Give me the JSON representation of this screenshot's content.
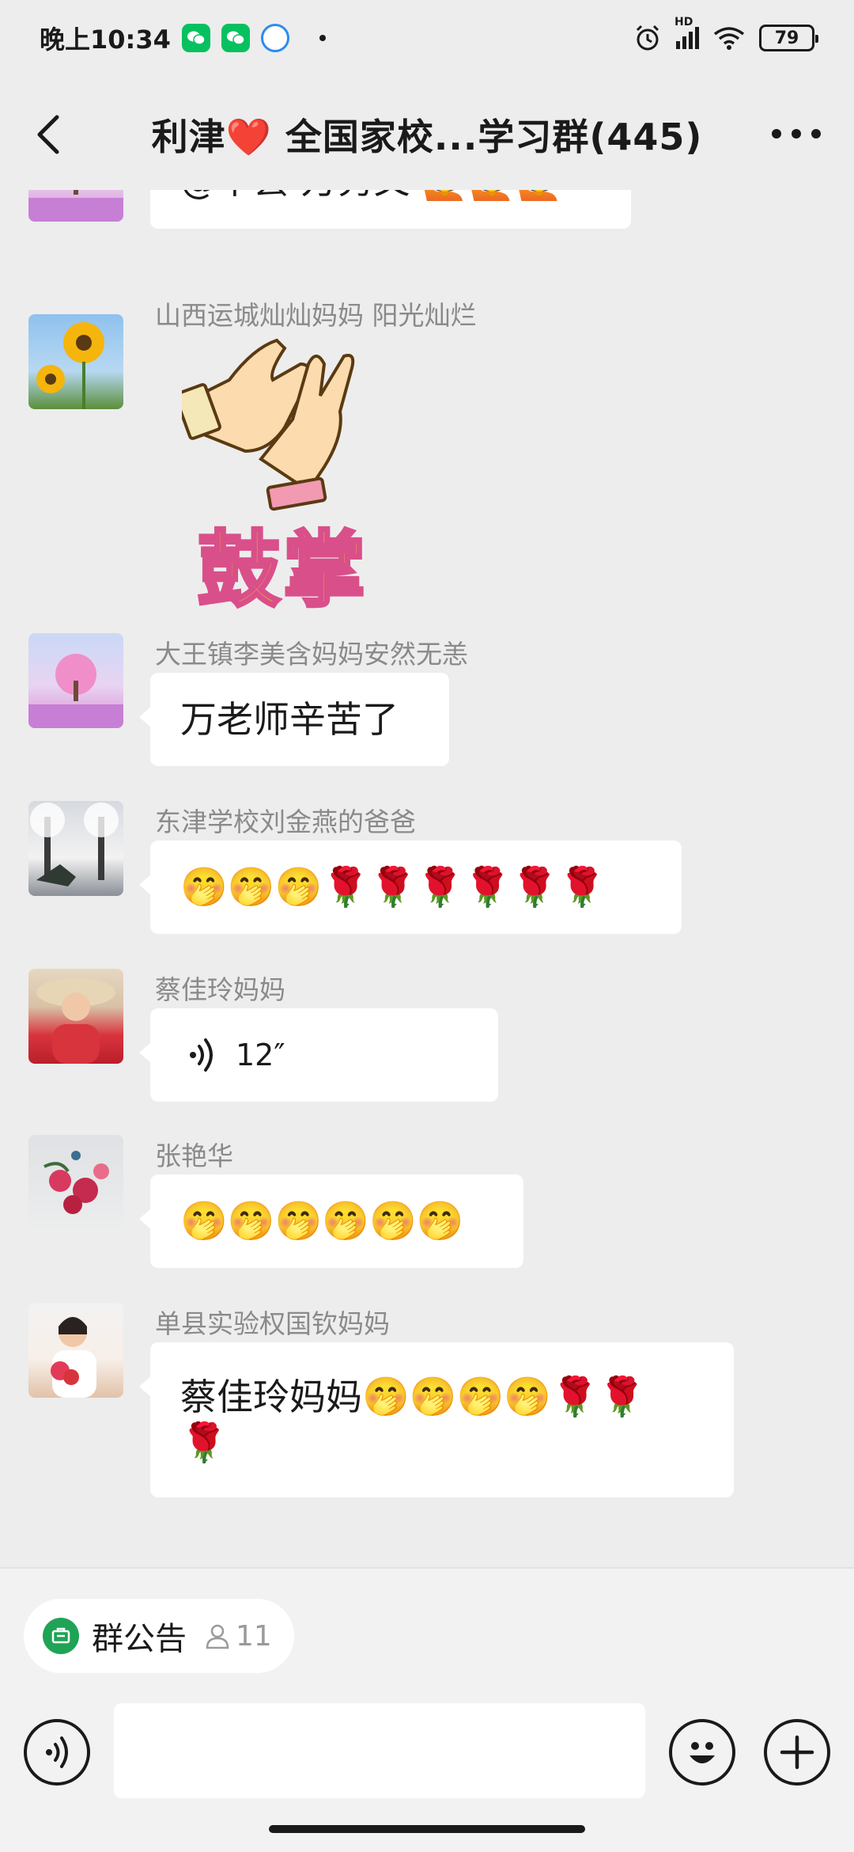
{
  "status_bar": {
    "time": "晚上10:34",
    "network_label": "HD",
    "battery": "79"
  },
  "header": {
    "title": "利津❤️ 全国家校...学习群(445)"
  },
  "messages": [
    {
      "sender": "",
      "text": "@单县 万秀文 ",
      "emoji": "🙋🙋🙋"
    },
    {
      "sender": "山西运城灿灿妈妈  阳光灿烂",
      "sticker_text": "鼓掌"
    },
    {
      "sender": "大王镇李美含妈妈安然无恙",
      "text": "万老师辛苦了"
    },
    {
      "sender": "东津学校刘金燕的爸爸",
      "emoji": "🤭🤭🤭🌹🌹🌹🌹🌹🌹"
    },
    {
      "sender": "蔡佳玲妈妈",
      "voice_duration": "12″"
    },
    {
      "sender": "张艳华",
      "emoji": "🤭🤭🤭🤭🤭🤭"
    },
    {
      "sender": "单县实验权国钦妈妈",
      "text": "蔡佳玲妈妈",
      "emoji_line1": "🤭🤭🤭🤭🌹🌹",
      "emoji_line2": "🌹"
    }
  ],
  "bottom": {
    "notice_label": "群公告",
    "member_count": "11"
  },
  "colors": {
    "background": "#ededed",
    "bubble": "#ffffff",
    "accent_green": "#07c160",
    "heart_red": "#e0202a",
    "sender_gray": "#8a8a8a"
  },
  "icons": {
    "back": "back-arrow-icon",
    "more": "more-dots-icon",
    "voice": "voice-wave-icon",
    "emoji": "smiley-face-icon",
    "plus": "plus-icon",
    "notice": "notice-icon",
    "person": "person-icon"
  }
}
